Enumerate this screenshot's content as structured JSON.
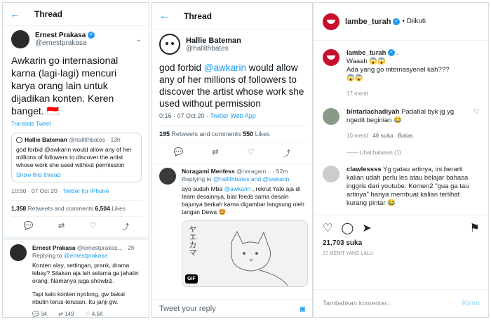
{
  "left": {
    "header": {
      "title": "Thread"
    },
    "tweet": {
      "name": "Ernest Prakasa",
      "handle": "@ernestprakasa",
      "text": "Awkarin go internasional karna (lagi-lagi) mencuri karya orang lain untuk dijadikan konten. Keren banget. 🇮🇩",
      "translate": "Translate Tweet",
      "quote_name": "Hallie Bateman",
      "quote_handle": "@hallithbates · 13h",
      "quote_text": "god forbid @awkarin would allow any of her millions of followers to discover the artist whose work she used without permission",
      "quote_show": "Show this thread",
      "time": "10:50 · 07 Oct 20 · ",
      "client": "Twitter for iPhone",
      "retweets": "1,358",
      "retweets_label": " Retweets and comments ",
      "likes": "6,504",
      "likes_label": " Likes"
    },
    "reply": {
      "name": "Ernest Prakasa",
      "handle": "@ernestprakas... · 2h",
      "replying": "Replying to ",
      "replying_to": "@ernestprakasa",
      "text1": "Konten alay, settingan, prank, drama lebay? Silakan aja lah selama ga jahatin orang. Namanya juga showbiz.",
      "text2": "Tapi kalo konten nyolong, gw bakal ributin terus-terusan. Itu janji gw.",
      "replies": "34",
      "retweets": "149",
      "likes": "4.5K"
    }
  },
  "middle": {
    "header": {
      "title": "Thread"
    },
    "tweet": {
      "name": "Hallie Bateman",
      "handle": "@hallithbates",
      "text_prefix": "god forbid ",
      "mention": "@awkarin",
      "text_suffix": " would allow any of her millions of followers to discover the artist whose work she used without permission",
      "time": "0:16 · 07 Oct 20 · ",
      "client": "Twitter Web App",
      "retweets": "195",
      "retweets_label": " Retweets and comments ",
      "likes": "550",
      "likes_label": " Likes"
    },
    "reply": {
      "name": "Noragami Menfess",
      "handle": "@noragam... · 52m",
      "replying": "Replying to ",
      "replying_to": "@hallithbates and @awkarin",
      "text_prefix": "ayo sudah Mba ",
      "mention": "@awkarin",
      "text_suffix": " , rekrut Yato aja di team desainnya, biar feeds sama desain bajunya berkah karna digambar langsung oleh tangan Dewa 🤩",
      "gif": "GIF",
      "sketch_text": "ヤエカマ"
    },
    "reply_box": {
      "placeholder": "Tweet your reply"
    }
  },
  "right": {
    "header": {
      "username": "lambe_turah",
      "follow": "• Diikuti"
    },
    "caption": {
      "username": "lambe_turah",
      "line1": "Waaah 😱😱",
      "line2": "Ada yang go internasyenel kah???",
      "line3": "😱😱",
      "time": "17 menit"
    },
    "comments": [
      {
        "username": "bintariachadiyah",
        "text": "Padahal byk jg yg ngedit beginian 😂",
        "time": "10 menit",
        "likes": "40 suka",
        "reply": "Balas",
        "view_replies": "Lihat balasan (1)"
      },
      {
        "username": "clawlessss",
        "text": "Yg gatau artinya, ini berarti kalian udah perlu les atau belajar bahasa inggris dari youtube. Komen2 \"gua ga tau artinya\" hanya membuat kalian terlihat kurang pintar 😂"
      }
    ],
    "likes": "21,703 suka",
    "posted": "17 MENIT YANG LALU",
    "comment_box": {
      "placeholder": "Tambahkan komentar...",
      "post": "Kirim"
    }
  }
}
